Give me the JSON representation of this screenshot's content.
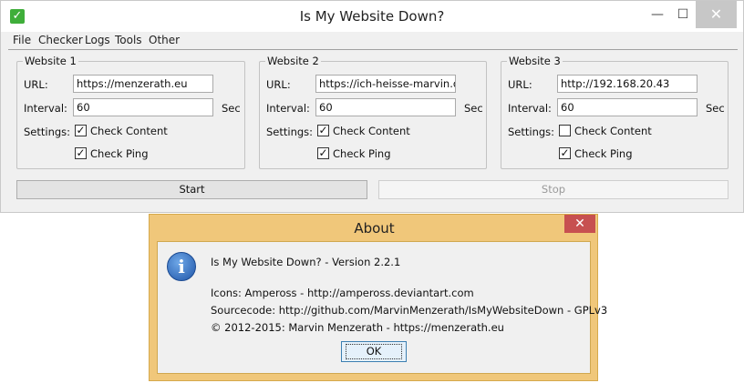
{
  "window": {
    "title": "Is My Website Down?",
    "minimize_glyph": "—",
    "maximize_glyph": "☐",
    "close_glyph": "✕"
  },
  "menu": [
    "File",
    "Checker",
    "Logs",
    "Tools",
    "Other"
  ],
  "labels": {
    "url": "URL:",
    "interval": "Interval:",
    "settings": "Settings:",
    "sec": "Sec"
  },
  "websites": [
    {
      "title": "Website 1",
      "url": "https://menzerath.eu",
      "interval": "60",
      "check_content": {
        "label": "Check Content",
        "checked": true
      },
      "check_ping": {
        "label": "Check Ping",
        "checked": true
      }
    },
    {
      "title": "Website 2",
      "url": "https://ich-heisse-marvin.de",
      "interval": "60",
      "check_content": {
        "label": "Check Content",
        "checked": true
      },
      "check_ping": {
        "label": "Check Ping",
        "checked": true
      }
    },
    {
      "title": "Website 3",
      "url": "http://192.168.20.43",
      "interval": "60",
      "check_content": {
        "label": "Check Content",
        "checked": false
      },
      "check_ping": {
        "label": "Check Ping",
        "checked": true
      }
    }
  ],
  "buttons": {
    "start": "Start",
    "stop": "Stop"
  },
  "about": {
    "title": "About",
    "close_glyph": "✕",
    "info_glyph": "i",
    "version": "Is My Website Down? - Version 2.2.1",
    "icons": "Icons: Ampeross - http://ampeross.deviantart.com",
    "sourcecode": "Sourcecode: http://github.com/MarvinMenzerath/IsMyWebsiteDown - GPLv3",
    "copyright": "© 2012-2015: Marvin Menzerath - https://menzerath.eu",
    "ok": "OK"
  },
  "colors": {
    "accent_check": "#3fae3a",
    "dialog_frame": "#f0c77a",
    "close_red": "#c75050"
  }
}
